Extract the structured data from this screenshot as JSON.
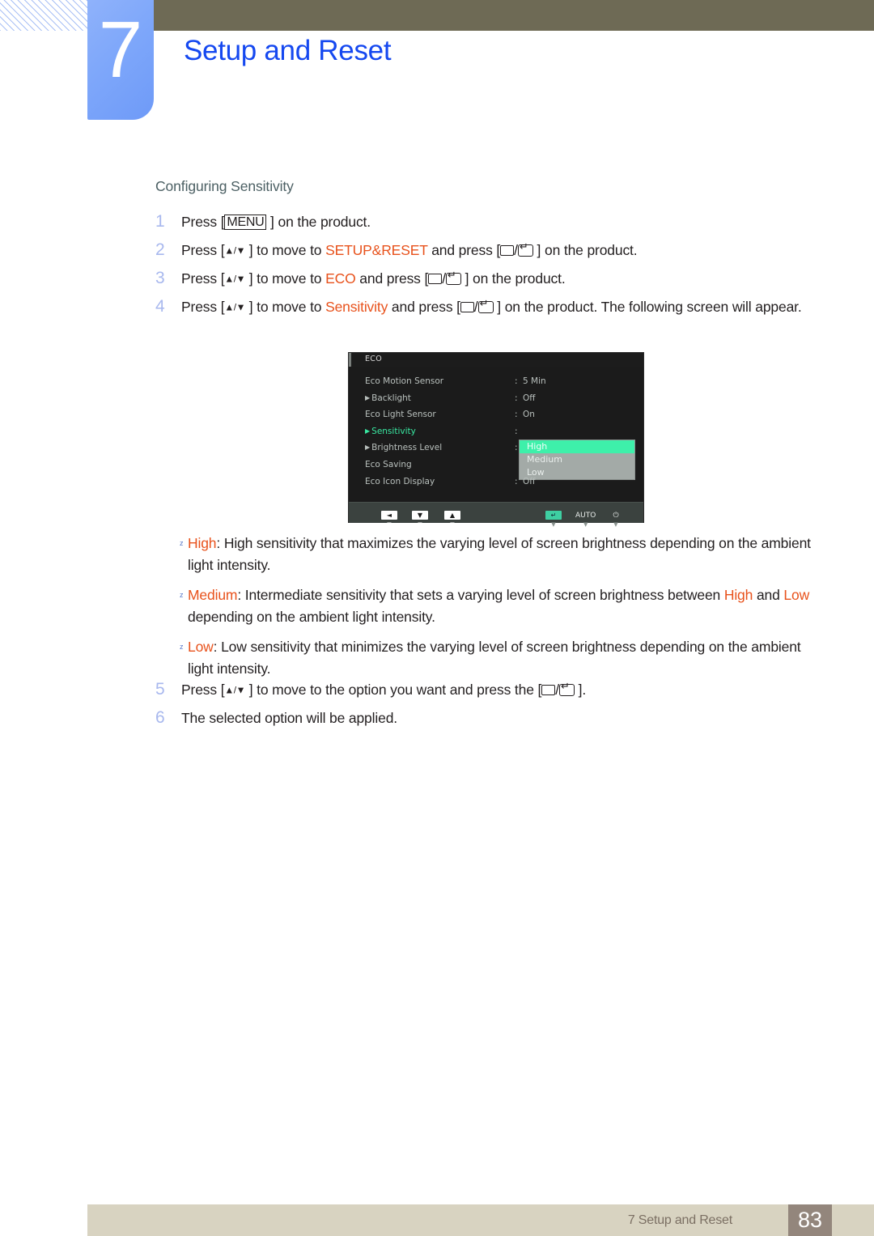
{
  "header": {
    "chapter_number": "7",
    "chapter_title": "Setup and Reset",
    "olive_bar_color": "#6e6a55",
    "badge_color": "#7ea7fa",
    "title_color": "#1548f0"
  },
  "section": {
    "heading": "Configuring Sensitivity"
  },
  "steps": [
    {
      "num": "1",
      "parts": [
        {
          "t": "Press [",
          "c": "plain"
        },
        {
          "t": "MENU",
          "c": "keybox"
        },
        {
          "t": " ] on the product.",
          "c": "plain"
        }
      ]
    },
    {
      "num": "2",
      "parts": [
        {
          "t": "Press [",
          "c": "plain"
        },
        {
          "t": "▲/▼",
          "c": "arrow"
        },
        {
          "t": " ] to move to ",
          "c": "plain"
        },
        {
          "t": "SETUP&RESET",
          "c": "orange"
        },
        {
          "t": " and press [",
          "c": "plain"
        },
        {
          "t": "rect",
          "c": "icon"
        },
        {
          "t": "/",
          "c": "plain"
        },
        {
          "t": "enter",
          "c": "icon"
        },
        {
          "t": " ] on the product.",
          "c": "plain"
        }
      ]
    },
    {
      "num": "3",
      "parts": [
        {
          "t": "Press [",
          "c": "plain"
        },
        {
          "t": "▲/▼",
          "c": "arrow"
        },
        {
          "t": " ] to move to ",
          "c": "plain"
        },
        {
          "t": "ECO",
          "c": "orange"
        },
        {
          "t": " and press [",
          "c": "plain"
        },
        {
          "t": "rect",
          "c": "icon"
        },
        {
          "t": "/",
          "c": "plain"
        },
        {
          "t": "enter",
          "c": "icon"
        },
        {
          "t": " ] on the product.",
          "c": "plain"
        }
      ]
    },
    {
      "num": "4",
      "parts": [
        {
          "t": "Press [",
          "c": "plain"
        },
        {
          "t": "▲/▼",
          "c": "arrow"
        },
        {
          "t": " ] to move to ",
          "c": "plain"
        },
        {
          "t": "Sensitivity",
          "c": "orange"
        },
        {
          "t": " and press [",
          "c": "plain"
        },
        {
          "t": "rect",
          "c": "icon"
        },
        {
          "t": "/",
          "c": "plain"
        },
        {
          "t": "enter",
          "c": "icon"
        },
        {
          "t": " ] on the product. The following screen will appear.",
          "c": "plain"
        }
      ]
    }
  ],
  "osd": {
    "title": "ECO",
    "rows": [
      {
        "label": "Eco Motion Sensor",
        "arrow": false,
        "colon": ":",
        "value": "5 Min",
        "active": false
      },
      {
        "label": "Backlight",
        "arrow": true,
        "colon": ":",
        "value": "Off",
        "active": false
      },
      {
        "label": "Eco Light Sensor",
        "arrow": false,
        "colon": ":",
        "value": "On",
        "active": false
      },
      {
        "label": "Sensitivity",
        "arrow": true,
        "colon": ":",
        "value": "",
        "active": true
      },
      {
        "label": "Brightness Level",
        "arrow": true,
        "colon": ":",
        "value": "",
        "active": false
      },
      {
        "label": "Eco Saving",
        "arrow": false,
        "colon": "",
        "value": "",
        "active": false
      },
      {
        "label": "Eco Icon Display",
        "arrow": false,
        "colon": ":",
        "value": "Off",
        "active": false
      }
    ],
    "dropdown": {
      "options": [
        "High",
        "Medium",
        "Low"
      ],
      "selected": "High",
      "highlight_color": "#3ef0aa",
      "background_color": "#a3aaa7"
    },
    "footer_buttons": [
      {
        "name": "left-arrow-button",
        "cap": "◄",
        "style": "white",
        "sub": "▼",
        "sub_dim": false
      },
      {
        "name": "down-arrow-button",
        "cap": "▼",
        "style": "white",
        "sub": "▼",
        "sub_dim": false
      },
      {
        "name": "up-arrow-button",
        "cap": "▲",
        "style": "white",
        "sub": "▼",
        "sub_dim": false
      },
      {
        "name": "enter-button",
        "cap": "↵",
        "style": "teal",
        "sub": "▼",
        "sub_dim": true
      },
      {
        "name": "auto-button",
        "cap": "AUTO",
        "style": "plain",
        "sub": "▼",
        "sub_dim": true
      },
      {
        "name": "power-button",
        "cap": "⏻",
        "style": "plain",
        "sub": "▼",
        "sub_dim": true
      }
    ]
  },
  "bullets": [
    {
      "mark": "z",
      "parts": [
        {
          "t": "High",
          "c": "orange"
        },
        {
          "t": ": High sensitivity that maximizes the varying level of screen brightness depending on the ambient light intensity.",
          "c": "plain"
        }
      ]
    },
    {
      "mark": "z",
      "parts": [
        {
          "t": "Medium",
          "c": "orange"
        },
        {
          "t": ": Intermediate sensitivity that sets a varying level of screen brightness between ",
          "c": "plain"
        },
        {
          "t": "High",
          "c": "orange"
        },
        {
          "t": " and ",
          "c": "plain"
        },
        {
          "t": "Low",
          "c": "orange"
        },
        {
          "t": " depending on the ambient light intensity.",
          "c": "plain"
        }
      ]
    },
    {
      "mark": "z",
      "parts": [
        {
          "t": "Low",
          "c": "orange"
        },
        {
          "t": ": Low sensitivity that minimizes the varying level of screen brightness depending on the ambient light intensity.",
          "c": "plain"
        }
      ]
    }
  ],
  "steps_tail": [
    {
      "num": "5",
      "parts": [
        {
          "t": "Press [",
          "c": "plain"
        },
        {
          "t": "▲/▼",
          "c": "arrow"
        },
        {
          "t": " ] to move to the option you want and press the [",
          "c": "plain"
        },
        {
          "t": "rect",
          "c": "icon"
        },
        {
          "t": "/",
          "c": "plain"
        },
        {
          "t": "enter",
          "c": "icon"
        },
        {
          "t": " ].",
          "c": "plain"
        }
      ]
    },
    {
      "num": "6",
      "parts": [
        {
          "t": "The selected option will be applied.",
          "c": "plain"
        }
      ]
    }
  ],
  "footer": {
    "text": "7 Setup and Reset",
    "page": "83",
    "bar_color": "#d8d3c1",
    "page_box_color": "#93867c"
  }
}
